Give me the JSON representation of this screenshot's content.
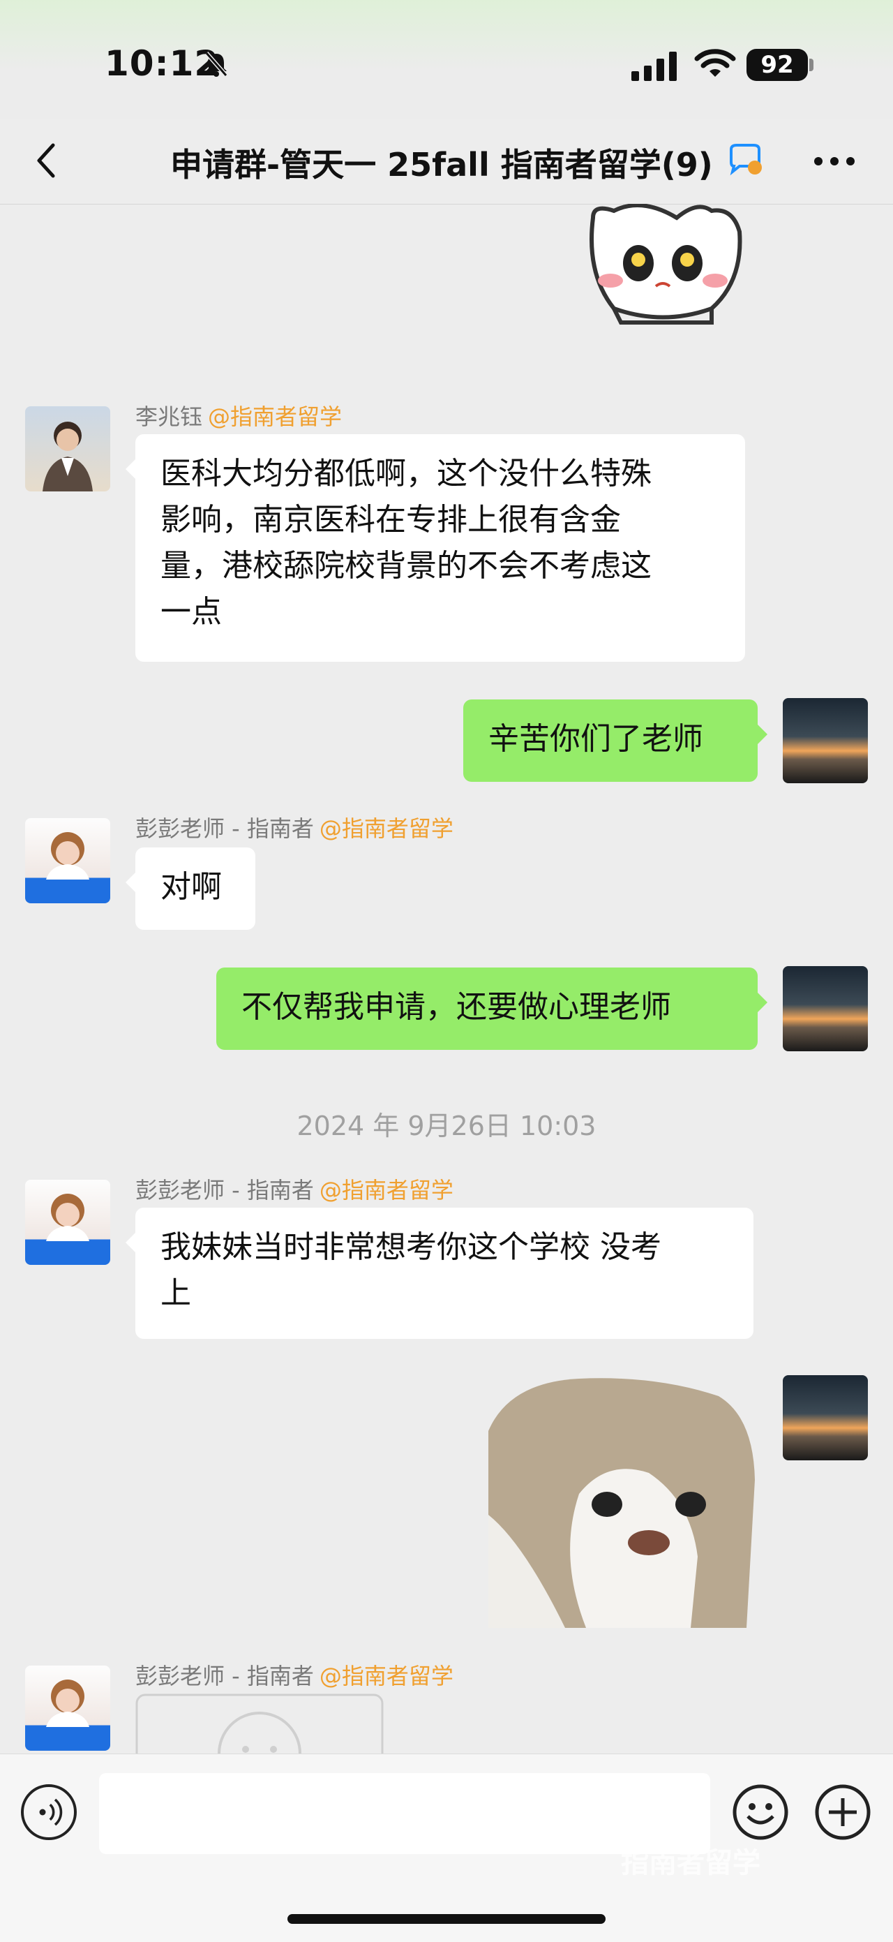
{
  "status_bar": {
    "time": "10:12",
    "battery": "92"
  },
  "nav": {
    "title": "申请群-管天一 25fall 指南者留学(9)"
  },
  "messages": [
    {
      "sender": "李兆钰",
      "tag": "@指南者留学",
      "lines": [
        "医科大均分都低啊，这个没什么特殊",
        "影响，南京医科在专排上很有含金",
        "量，港校舔院校背景的不会不考虑这",
        "一点"
      ]
    },
    {
      "text": "辛苦你们了老师"
    },
    {
      "sender": "彭彭老师 - 指南者",
      "tag": "@指南者留学",
      "text": "对啊"
    },
    {
      "text": "不仅帮我申请，还要做心理老师"
    },
    {
      "sender": "彭彭老师 - 指南者",
      "tag": "@指南者留学",
      "lines": [
        "我妹妹当时非常想考你这个学校 没考",
        "上"
      ]
    },
    {
      "sender": "彭彭老师 - 指南者",
      "tag": "@指南者留学"
    }
  ],
  "timestamp": "2024 年 9月26日 10:03",
  "watermark": "指南者留学",
  "colors": {
    "out_bubble": "#95ec69",
    "in_bubble": "#ffffff",
    "tag": "#f0a030",
    "background": "#ededed"
  }
}
